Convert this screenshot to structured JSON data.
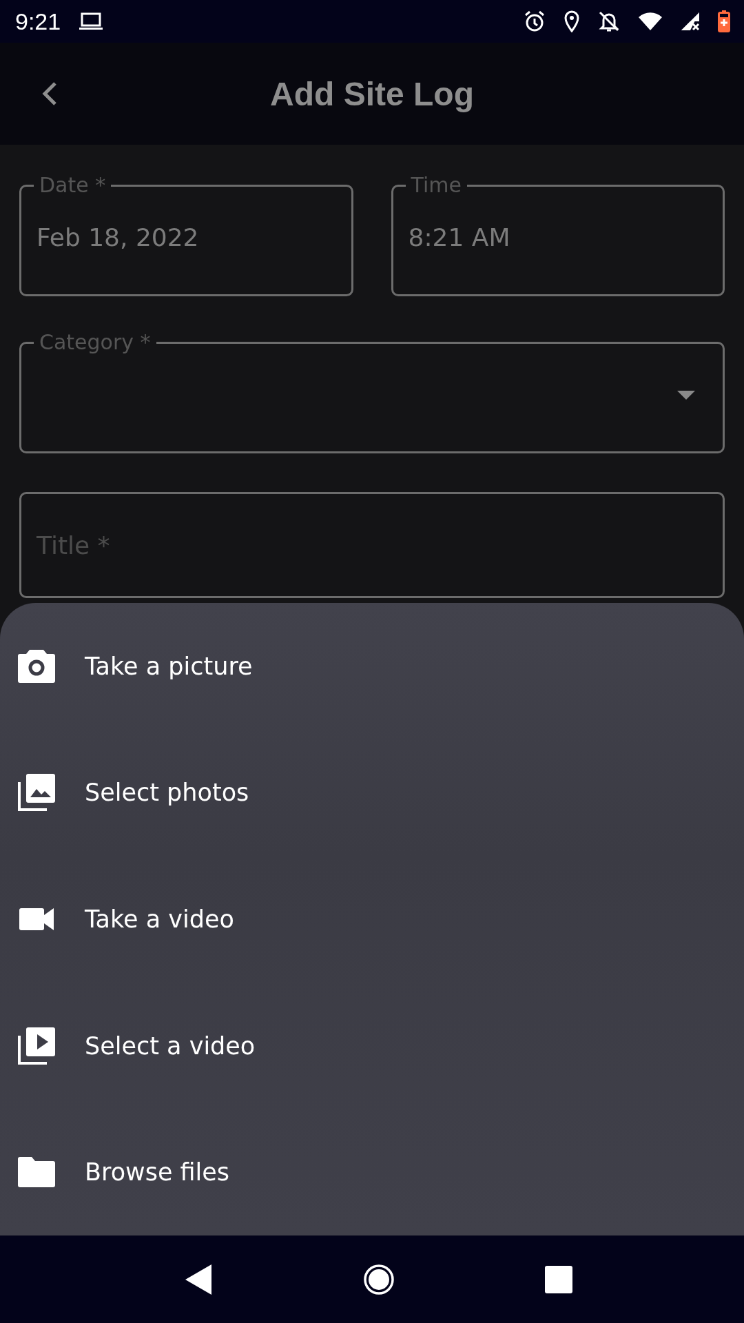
{
  "status_bar": {
    "time": "9:21"
  },
  "app_bar": {
    "title": "Add Site Log"
  },
  "form": {
    "fields": [
      {
        "kind": "text",
        "label": "Date *",
        "value": "Feb 18, 2022"
      },
      {
        "kind": "text",
        "label": "Time",
        "value": "8:21 AM"
      },
      {
        "kind": "dropdown",
        "label": "Category *"
      },
      {
        "kind": "text",
        "placeholder": "Title *"
      }
    ]
  },
  "sheet": {
    "items": [
      {
        "label": "Take a picture"
      },
      {
        "label": "Select photos"
      },
      {
        "label": "Take a video"
      },
      {
        "label": "Select a video"
      },
      {
        "label": "Browse files"
      }
    ]
  }
}
